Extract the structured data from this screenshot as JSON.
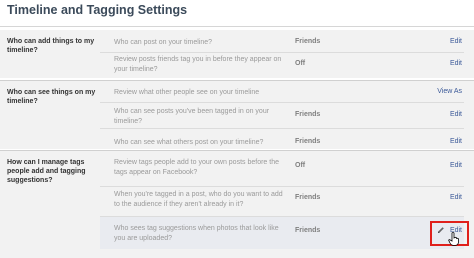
{
  "page": {
    "title": "Timeline and Tagging Settings"
  },
  "sections": [
    {
      "label": "Who can add things to my timeline?",
      "rows": [
        {
          "text": "Who can post on your timeline?",
          "value": "Friends",
          "action": "Edit"
        },
        {
          "text": "Review posts friends tag you in before they appear on your timeline?",
          "value": "Off",
          "action": "Edit"
        }
      ]
    },
    {
      "label": "Who can see things on my timeline?",
      "rows": [
        {
          "text": "Review what other people see on your timeline",
          "value": "",
          "action": "View As"
        },
        {
          "text": "Who can see posts you've been tagged in on your timeline?",
          "value": "Friends",
          "action": "Edit"
        },
        {
          "text": "Who can see what others post on your timeline?",
          "value": "Friends",
          "action": "Edit"
        }
      ]
    },
    {
      "label": "How can I manage tags people add and tagging suggestions?",
      "rows": [
        {
          "text": "Review tags people add to your own posts before the tags appear on Facebook?",
          "value": "Off",
          "action": "Edit"
        },
        {
          "text": "When you're tagged in a post, who do you want to add to the audience if they aren't already in it?",
          "value": "Friends",
          "action": "Edit"
        },
        {
          "text": "Who sees tag suggestions when photos that look like you are uploaded?",
          "value": "Friends",
          "action": "Edit"
        }
      ]
    }
  ],
  "icons": {
    "edit": "pencil-icon",
    "cursor": "hand-cursor-icon"
  },
  "colors": {
    "link": "#3b5998",
    "highlight": "#e0201b",
    "section_bg": "#f2f2f2"
  }
}
